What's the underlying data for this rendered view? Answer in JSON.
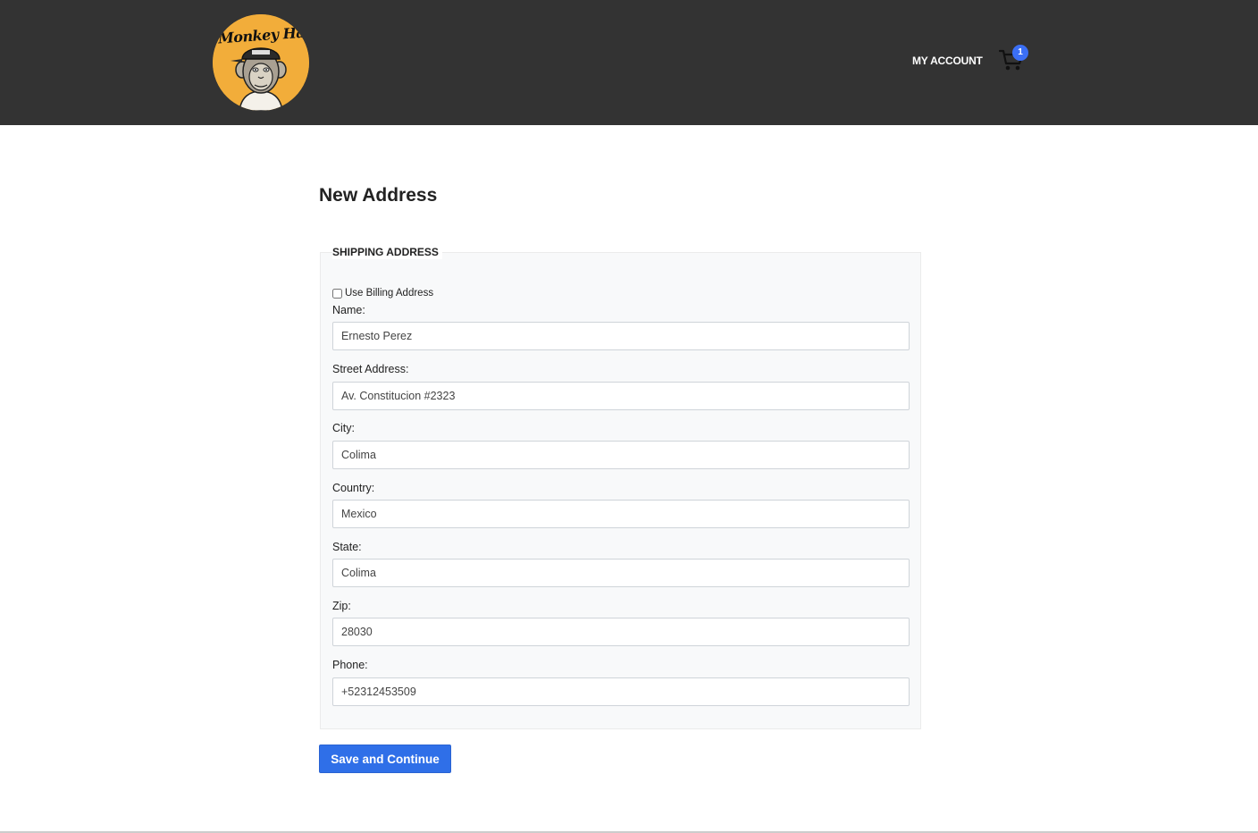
{
  "header": {
    "logo_text": "Monkey Hats",
    "account_label": "MY ACCOUNT",
    "cart_count": "1",
    "colors": {
      "background": "#333333",
      "logo_circle": "#f2ad3a",
      "badge": "#3b6ff5"
    }
  },
  "page": {
    "title": "New Address"
  },
  "form": {
    "legend": "SHIPPING ADDRESS",
    "use_billing_label": "Use Billing Address",
    "use_billing_checked": false,
    "fields": [
      {
        "label": "Name:",
        "value": "Ernesto Perez"
      },
      {
        "label": "Street Address:",
        "value": "Av. Constitucion #2323"
      },
      {
        "label": "City:",
        "value": "Colima"
      },
      {
        "label": "Country:",
        "value": "Mexico"
      },
      {
        "label": "State:",
        "value": "Colima"
      },
      {
        "label": "Zip:",
        "value": "28030"
      },
      {
        "label": "Phone:",
        "value": "+52312453509"
      }
    ],
    "submit_label": "Save and Continue",
    "colors": {
      "submit": "#2f6fe8"
    }
  }
}
